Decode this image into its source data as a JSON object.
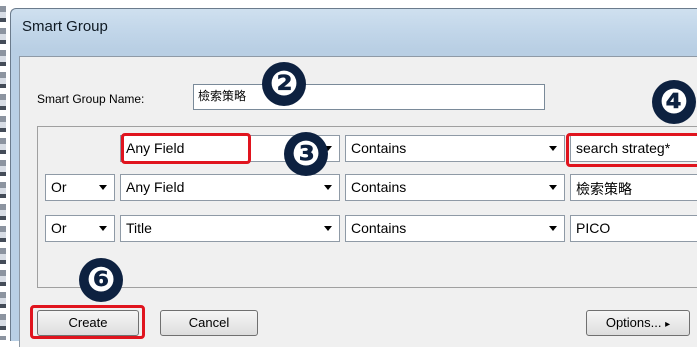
{
  "window": {
    "title": "Smart Group"
  },
  "name_field": {
    "label": "Smart Group Name:",
    "value": "檢索策略"
  },
  "criteria": [
    {
      "connector": "",
      "field": "Any Field",
      "operator": "Contains",
      "value": "search strateg*"
    },
    {
      "connector": "Or",
      "field": "Any Field",
      "operator": "Contains",
      "value": "檢索策略"
    },
    {
      "connector": "Or",
      "field": "Title",
      "operator": "Contains",
      "value": "PICO"
    }
  ],
  "badges": {
    "b2": "❷",
    "b3": "❸",
    "b4": "❹",
    "b6": "❻"
  },
  "buttons": {
    "create": "Create",
    "cancel": "Cancel",
    "options": "Options...",
    "options_arrow": "▸"
  },
  "colors": {
    "highlight": "#e0141e",
    "badge": "#0d2140"
  }
}
